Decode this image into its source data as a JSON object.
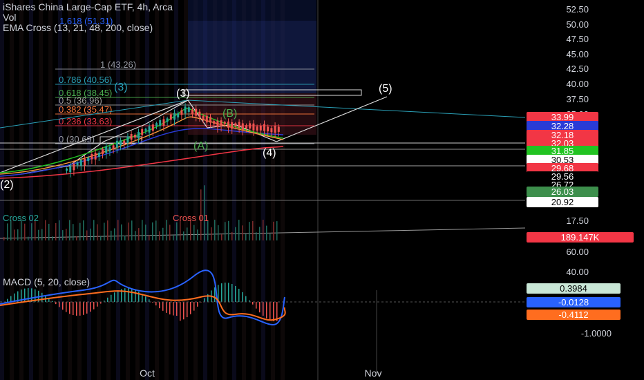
{
  "header": {
    "title": "iShares China Large-Cap ETF, 4h, Arca",
    "vol": "Vol",
    "ema": "EMA Cross (13, 21, 48, 200, close)",
    "macd": "MACD (5, 20, close)"
  },
  "chart_data": {
    "type": "line",
    "price_axis": [
      "52.50",
      "50.00",
      "47.50",
      "45.00",
      "42.50",
      "40.00",
      "37.50",
      "35.00"
    ],
    "volume_axis": [
      "17.50",
      "60.00",
      "40.00"
    ],
    "macd_axis": [
      "-1.0000"
    ],
    "x_axis": [
      "Oct",
      "Nov"
    ],
    "price_tags": [
      {
        "text": "33.99",
        "bg": "#f23645",
        "fg": "#ffffff"
      },
      {
        "text": "32.28",
        "bg": "#2a3bd6",
        "fg": "#ffffff"
      },
      {
        "text": "32.18",
        "bg": "#f23645",
        "fg": "#ffffff"
      },
      {
        "text": "32.03",
        "bg": "#f23645",
        "fg": "#ffffff"
      },
      {
        "text": "31.85",
        "bg": "#22c322",
        "fg": "#ffffff"
      },
      {
        "text": "30.53",
        "bg": "#ffffff",
        "fg": "#000000"
      },
      {
        "text": "29.68",
        "bg": "#f23645",
        "fg": "#ffffff"
      },
      {
        "text": "29.56",
        "bg": "#000000",
        "fg": "#ffffff"
      },
      {
        "text": "26.72",
        "bg": "#000000",
        "fg": "#ffffff"
      },
      {
        "text": "26.03",
        "bg": "#3d8f4c",
        "fg": "#ffffff"
      },
      {
        "text": "20.92",
        "bg": "#ffffff",
        "fg": "#000000"
      }
    ],
    "volume_tag": {
      "text": "189.147K",
      "bg": "#f23645",
      "fg": "#ffffff"
    },
    "macd_tags": [
      {
        "text": "0.3984",
        "bg": "#c8e6d6",
        "fg": "#000000"
      },
      {
        "text": "-0.0128",
        "bg": "#2962ff",
        "fg": "#ffffff"
      },
      {
        "text": "-0.4112",
        "bg": "#ff6d1f",
        "fg": "#ffffff"
      }
    ],
    "fib_levels": [
      {
        "label": "1 (43.26)",
        "color": "#9598a1"
      },
      {
        "label": "0.786 (40.56)",
        "color": "#2aa1b8"
      },
      {
        "label": "0.618 (38.45)",
        "color": "#4caf50"
      },
      {
        "label": "0.5 (36.96)",
        "color": "#9e9e9e"
      },
      {
        "label": "0.382 (35.47)",
        "color": "#ff7a3d"
      },
      {
        "label": "0.236 (33.63)",
        "color": "#f23645"
      },
      {
        "label": "0 (30.69)",
        "color": "#9598a1"
      }
    ],
    "fib_top": "1.618 (51.31)",
    "waves": [
      "(2)",
      "(3)",
      "(3)",
      "(4)",
      "(5)",
      "(A)",
      "(B)"
    ],
    "cross_labels": [
      "Cross 02",
      "Cross 01"
    ]
  }
}
